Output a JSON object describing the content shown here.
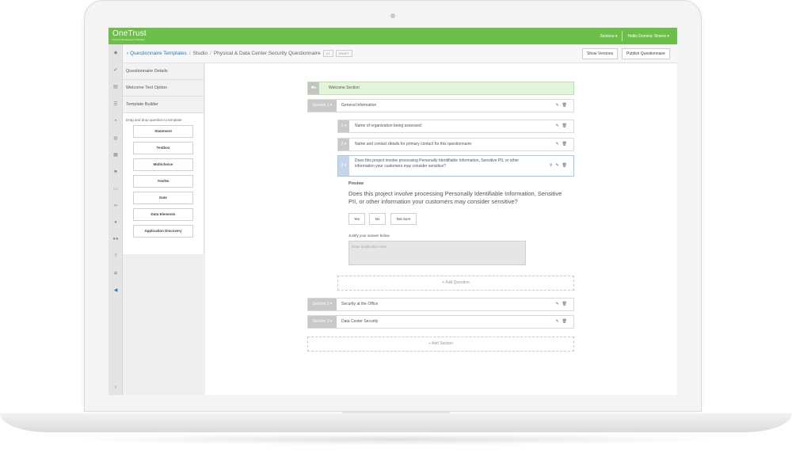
{
  "brand": {
    "name": "OneTrust",
    "subtitle": "Privacy Management Software"
  },
  "user_menu": {
    "org": "Zentosa ▾",
    "user": "Hellio Dominic Sinens ▾"
  },
  "breadcrumb": {
    "back_link": "‹ Questionnaire Templates",
    "studio": "Studio",
    "current": "Physical & Data Center Security Questionnaire",
    "version_tag": "V1",
    "status_tag": "DRAFT"
  },
  "toolbar": {
    "show_versions": "Show Versions",
    "publish": "Publish Questionnaire"
  },
  "rail_icons": [
    "home-icon",
    "check-icon",
    "document-icon",
    "list-icon",
    "dashboard-icon",
    "globe-icon",
    "table-icon",
    "flag-icon",
    "folder-icon",
    "link-icon",
    "user-icon",
    "users-icon",
    "help-icon",
    "gear-icon",
    "megaphone-icon"
  ],
  "left_panel": {
    "items": [
      "Questionnaire Details",
      "Welcome Text Option",
      "Template Builder"
    ],
    "hint": "Drag and drop question to template.",
    "question_types": [
      "Statement",
      "Textbox",
      "Multichoice",
      "Yes/No",
      "Date",
      "Data Elements",
      "Application Discovery"
    ]
  },
  "welcome": {
    "label": "Welcome Section"
  },
  "sections": [
    {
      "badge": "Section 1 ▾",
      "title": "General Information"
    },
    {
      "badge": "Section 2 ▾",
      "title": "Security at the Office"
    },
    {
      "badge": "Section 3 ▾",
      "title": "Data Center Security"
    }
  ],
  "questions": [
    {
      "badge": "1 ▾",
      "text": "Name of organization being assessed:"
    },
    {
      "badge": "2 ▾",
      "text": "Name and contact details for primary contact for this questionnaire:"
    },
    {
      "badge": "3 ▾",
      "text": "Does this project involve processing Personally Identifiable Information, Sensitive PII, or other information your customers may consider sensitive?"
    }
  ],
  "preview": {
    "title": "Preview",
    "question": "Does this project involve processing Personally Identifiable Information, Sensitive PII, or other information your customers may consider sensitive?",
    "answers": [
      "Yes",
      "No",
      "Not Sure"
    ],
    "justify_label": "Justify your answer below.",
    "justify_placeholder": "Enter justification here."
  },
  "add_question": "+ Add Question",
  "add_section": "+ Add Section"
}
